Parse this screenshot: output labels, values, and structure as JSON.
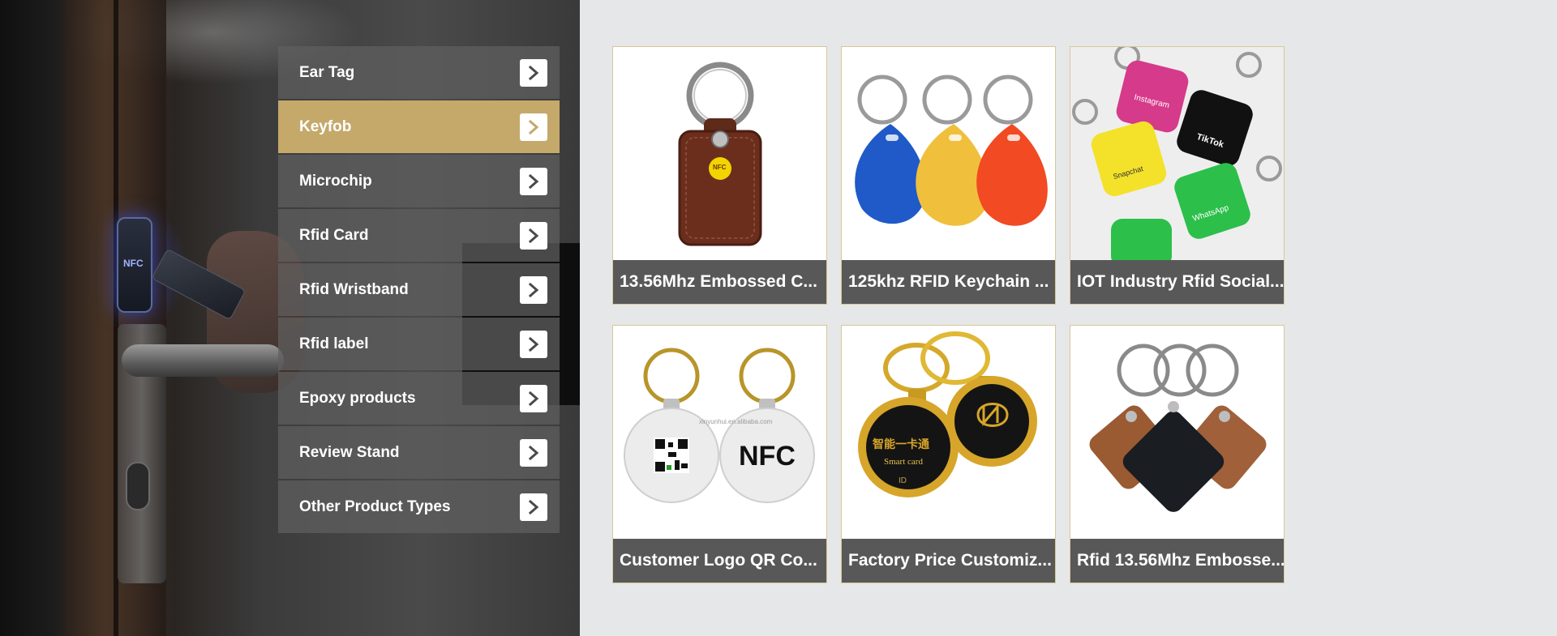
{
  "menu": {
    "items": [
      {
        "label": "Ear Tag",
        "active": false,
        "icon": "chevron-right-icon"
      },
      {
        "label": "Keyfob",
        "active": true,
        "icon": "chevron-right-icon"
      },
      {
        "label": "Microchip",
        "active": false,
        "icon": "chevron-right-icon"
      },
      {
        "label": "Rfid Card",
        "active": false,
        "icon": "chevron-right-icon"
      },
      {
        "label": "Rfid Wristband",
        "active": false,
        "icon": "chevron-right-icon"
      },
      {
        "label": "Rfid label",
        "active": false,
        "icon": "chevron-right-icon"
      },
      {
        "label": "Epoxy products",
        "active": false,
        "icon": "chevron-right-icon"
      },
      {
        "label": "Review Stand",
        "active": false,
        "icon": "chevron-right-icon"
      },
      {
        "label": "Other Product Types",
        "active": false,
        "icon": "chevron-right-icon"
      }
    ]
  },
  "hero": {
    "reader_text": "NFC"
  },
  "products": [
    {
      "title": "13.56Mhz Embossed C...",
      "image": "brown-leather-nfc-keyfob",
      "badge": "NFC"
    },
    {
      "title": "125khz RFID Keychain ...",
      "image": "blue-yellow-red-teardrop-keyfobs"
    },
    {
      "title": "IOT Industry Rfid Social...",
      "image": "social-media-acrylic-keychains",
      "tags": [
        "Instagram",
        "TikTok",
        "Snapchat",
        "WhatsApp"
      ]
    },
    {
      "title": "Customer Logo QR Co...",
      "image": "epoxy-qr-nfc-round-tags",
      "tag_text": "NFC",
      "watermark": "xinyunhui.en.alibaba.com"
    },
    {
      "title": "Factory Price Customiz...",
      "image": "gold-metal-nfc-keychains",
      "tag_text": "Smart card",
      "tag_id": "ID",
      "tag_cn": "智能一卡通"
    },
    {
      "title": "Rfid 13.56Mhz Embosse...",
      "image": "leather-diamond-keyfobs"
    }
  ],
  "colors": {
    "active": "#c4a96b",
    "menu_bg": "#5f5f5f",
    "title_bar": "#585858",
    "page_bg": "#e6e7e8",
    "card_border": "#d8c79a"
  }
}
